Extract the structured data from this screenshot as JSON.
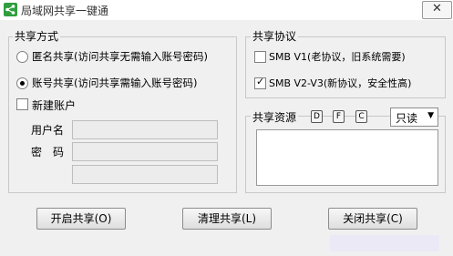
{
  "window": {
    "title": "局域网共享一键通"
  },
  "share_mode": {
    "group_title": "共享方式",
    "options": [
      {
        "label": "匿名共享(访问共享无需输入账号密码)",
        "checked": false
      },
      {
        "label": "账号共享(访问共享需输入账号密码)",
        "checked": true
      }
    ],
    "new_account_label": "新建账户",
    "username_label": "用户名",
    "password_label": "密　码",
    "username_value": "",
    "password_value": "",
    "confirm_value": ""
  },
  "protocol": {
    "group_title": "共享协议",
    "options": [
      {
        "label": "SMB V1(老协议，旧系统需要)",
        "checked": false
      },
      {
        "label": "SMB V2-V3(新协议，安全性高)",
        "checked": true
      }
    ]
  },
  "resources": {
    "label": "共享资源",
    "drive_buttons": [
      "D",
      "F",
      "C"
    ],
    "mode_select": "只读",
    "list_items": []
  },
  "actions": {
    "start": "开启共享(O)",
    "clear": "清理共享(L)",
    "close": "关闭共享(C)"
  }
}
